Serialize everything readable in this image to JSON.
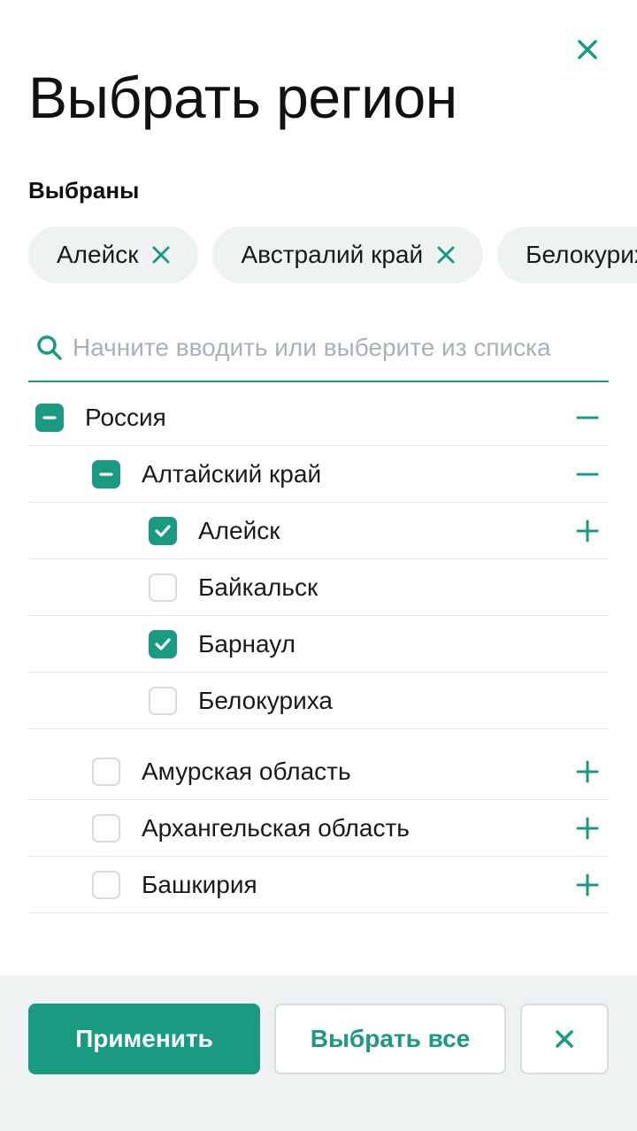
{
  "modal": {
    "title": "Выбрать регион"
  },
  "selected": {
    "label": "Выбраны",
    "chips": [
      "Алейск",
      "Австралий край",
      "Белокуриха"
    ]
  },
  "search": {
    "placeholder": "Начните вводить или выберите из списка",
    "value": ""
  },
  "tree": {
    "items": [
      {
        "label": "Россия",
        "level": 0,
        "state": "partial",
        "toggle": "collapse"
      },
      {
        "label": "Алтайский край",
        "level": 1,
        "state": "partial",
        "toggle": "collapse"
      },
      {
        "label": "Алейск",
        "level": 2,
        "state": "checked",
        "toggle": "expand"
      },
      {
        "label": "Байкальск",
        "level": 2,
        "state": "unchecked",
        "toggle": ""
      },
      {
        "label": "Барнаул",
        "level": 2,
        "state": "checked",
        "toggle": ""
      },
      {
        "label": "Белокуриха",
        "level": 2,
        "state": "unchecked",
        "toggle": ""
      },
      {
        "label": "Амурская область",
        "level": 1,
        "state": "unchecked",
        "toggle": "expand"
      },
      {
        "label": "Архангельская область",
        "level": 1,
        "state": "unchecked",
        "toggle": "expand"
      },
      {
        "label": "Башкирия",
        "level": 1,
        "state": "unchecked",
        "toggle": "expand"
      }
    ]
  },
  "footer": {
    "apply_label": "Применить",
    "select_all_label": "Выбрать все"
  },
  "colors": {
    "accent": "#1a9a80",
    "chip_bg": "#eff2f3",
    "placeholder": "#a9b1b8",
    "border": "#d6dcdf"
  },
  "icons": {
    "close": "close-icon",
    "search": "search-icon",
    "check": "check-icon",
    "minus": "minus-icon",
    "plus": "plus-icon"
  }
}
